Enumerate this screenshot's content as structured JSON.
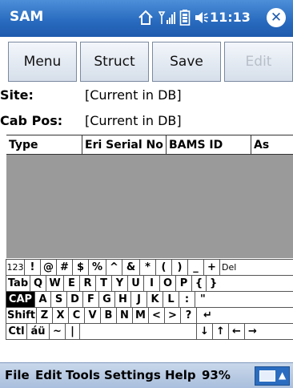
{
  "titlebar": {
    "app_title": "SAM",
    "time": "11:13",
    "icons": [
      "home-icon",
      "signal-icon",
      "battery-icon",
      "volume-icon",
      "close-icon"
    ]
  },
  "toolbar": {
    "menu": "Menu",
    "struct": "Struct",
    "save": "Save",
    "edit": "Edit"
  },
  "fields": {
    "site_label": "Site:",
    "site_value": "[Current in DB]",
    "cabpos_label": "Cab Pos:",
    "cabpos_value": "[Current in DB]"
  },
  "list": {
    "columns": [
      "Type",
      "Eri Serial No",
      "BAMS ID",
      "As"
    ]
  },
  "keyboard": {
    "row1": [
      "123",
      "!",
      "@",
      "#",
      "$",
      "%",
      "^",
      "&",
      "*",
      "(",
      ")",
      "_",
      "+",
      "Del"
    ],
    "row2": [
      "Tab",
      "Q",
      "W",
      "E",
      "R",
      "T",
      "Y",
      "U",
      "I",
      "O",
      "P",
      "{",
      "}"
    ],
    "row3": [
      "CAP",
      "A",
      "S",
      "D",
      "F",
      "G",
      "H",
      "J",
      "K",
      "L",
      ":",
      "\""
    ],
    "row4": [
      "Shift",
      "Z",
      "X",
      "C",
      "V",
      "B",
      "N",
      "M",
      "<",
      ">",
      "?",
      "↵"
    ],
    "row5": [
      "Ctl",
      "áü",
      "~",
      "|",
      "",
      "↓",
      "↑",
      "←",
      "→"
    ]
  },
  "menubar": {
    "file": "File",
    "edit": "Edit",
    "tools": "Tools",
    "settings": "Settings",
    "help": "Help",
    "zoom": "93%"
  }
}
